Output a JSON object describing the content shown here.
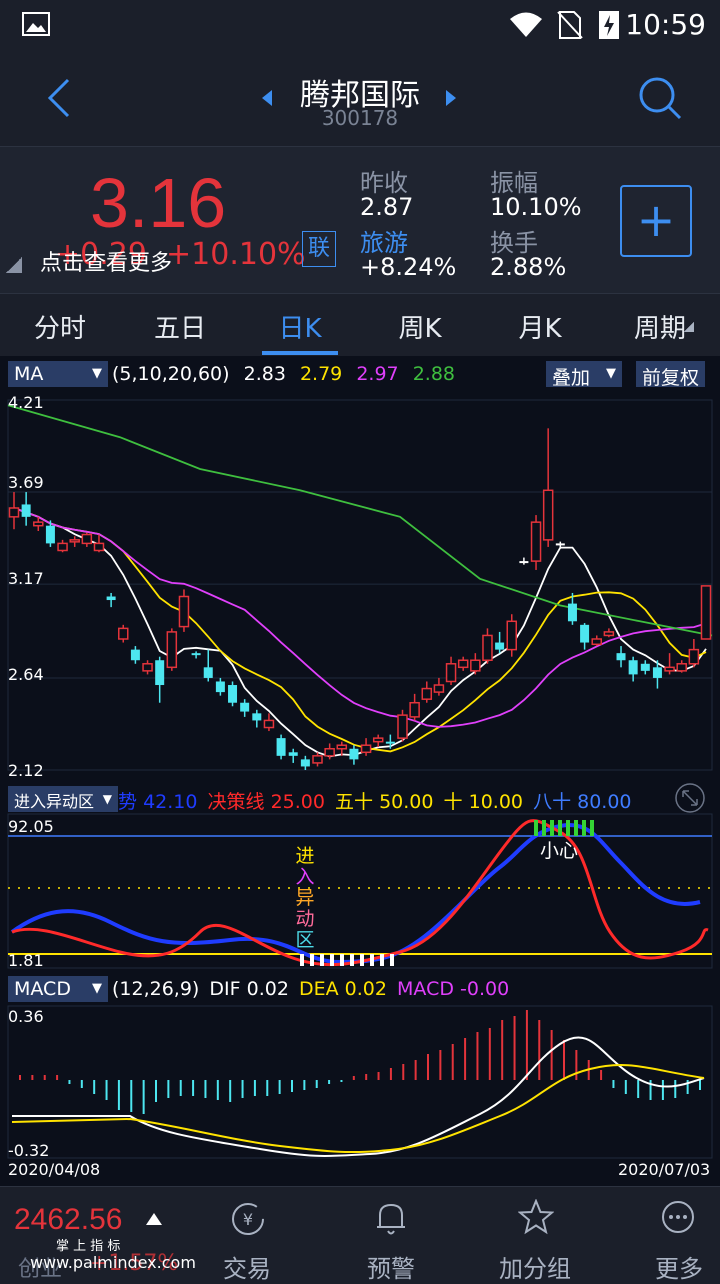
{
  "status": {
    "time": "10:59"
  },
  "header": {
    "title": "腾邦国际",
    "code": "300178"
  },
  "quote": {
    "price": "3.16",
    "change": "+0.29",
    "change_pct": "+10.10%",
    "hint": "点击查看更多",
    "link_badge": "联",
    "prev_close_label": "昨收",
    "prev_close": "2.87",
    "sector_label": "旅游",
    "sector_value": "+8.24%",
    "amplitude_label": "振幅",
    "amplitude": "10.10%",
    "turnover_label": "换手",
    "turnover": "2.88%",
    "add_symbol": "+"
  },
  "tabs": [
    "分时",
    "五日",
    "日K",
    "周K",
    "月K",
    "周期"
  ],
  "active_tab": 2,
  "ma": {
    "selector": "MA",
    "params": "(5,10,20,60)",
    "v5": "2.83",
    "v10": "2.79",
    "v20": "2.97",
    "v60": "2.88",
    "overlay": "叠加",
    "adjust": "前复权",
    "y_ticks": [
      "4.21",
      "3.69",
      "3.17",
      "2.64",
      "2.12"
    ]
  },
  "indicator2": {
    "selector": "进入异动区",
    "labels": [
      {
        "name": "势",
        "value": "42.10",
        "color": "#1f3cff"
      },
      {
        "name": "决策线",
        "value": "25.00",
        "color": "#ff2a2a"
      },
      {
        "name": "五十",
        "value": "50.00",
        "color": "#ffe300"
      },
      {
        "name": "十",
        "value": "10.00",
        "color": "#ffe300"
      },
      {
        "name": "八十",
        "value": "80.00",
        "color": "#3f7cff"
      }
    ],
    "top": "92.05",
    "bottom": "1.81",
    "vtext": [
      "进",
      "入",
      "异",
      "动",
      "区"
    ],
    "careful": "小心"
  },
  "macd": {
    "selector": "MACD",
    "params": "(12,26,9)",
    "dif_label": "DIF",
    "dif": "0.02",
    "dea_label": "DEA",
    "dea": "0.02",
    "macd_label": "MACD",
    "macd": "-0.00",
    "top": "0.36",
    "bottom": "-0.32",
    "date_start": "2020/04/08",
    "date_end": "2020/07/03"
  },
  "bottom": {
    "index_value": "2462.56",
    "index_name": "创业",
    "index_change": "+1.57%",
    "watermark": "掌 上 指 标",
    "watermark_url": "www.palmindex.com",
    "nav": [
      "交易",
      "预警",
      "加分组",
      "更多"
    ]
  },
  "chart_data": {
    "type": "candlestick",
    "candles": [
      [
        3.55,
        3.6,
        3.69,
        3.48,
        "up"
      ],
      [
        3.62,
        3.55,
        3.69,
        3.5,
        "down"
      ],
      [
        3.52,
        3.5,
        3.55,
        3.47,
        "up"
      ],
      [
        3.5,
        3.4,
        3.53,
        3.38,
        "down"
      ],
      [
        3.36,
        3.4,
        3.42,
        3.35,
        "up"
      ],
      [
        3.42,
        3.41,
        3.44,
        3.38,
        "up"
      ],
      [
        3.45,
        3.4,
        3.46,
        3.38,
        "up"
      ],
      [
        3.4,
        3.36,
        3.45,
        3.35,
        "up"
      ],
      [
        3.1,
        3.08,
        3.12,
        3.04,
        "down"
      ],
      [
        2.92,
        2.86,
        2.94,
        2.84,
        "up"
      ],
      [
        2.8,
        2.74,
        2.82,
        2.72,
        "down"
      ],
      [
        2.72,
        2.68,
        2.74,
        2.66,
        "up"
      ],
      [
        2.74,
        2.6,
        2.76,
        2.5,
        "down"
      ],
      [
        2.7,
        2.9,
        2.92,
        2.68,
        "up"
      ],
      [
        2.93,
        3.1,
        3.14,
        2.9,
        "up"
      ],
      [
        2.78,
        2.77,
        2.79,
        2.75,
        "down"
      ],
      [
        2.7,
        2.64,
        2.8,
        2.62,
        "down"
      ],
      [
        2.62,
        2.56,
        2.64,
        2.54,
        "down"
      ],
      [
        2.6,
        2.5,
        2.62,
        2.48,
        "down"
      ],
      [
        2.5,
        2.45,
        2.52,
        2.42,
        "down"
      ],
      [
        2.44,
        2.4,
        2.46,
        2.36,
        "down"
      ],
      [
        2.4,
        2.36,
        2.44,
        2.34,
        "up"
      ],
      [
        2.3,
        2.2,
        2.32,
        2.18,
        "down"
      ],
      [
        2.22,
        2.2,
        2.24,
        2.16,
        "down"
      ],
      [
        2.18,
        2.14,
        2.2,
        2.12,
        "down"
      ],
      [
        2.16,
        2.2,
        2.22,
        2.14,
        "up"
      ],
      [
        2.2,
        2.24,
        2.27,
        2.18,
        "up"
      ],
      [
        2.24,
        2.26,
        2.28,
        2.2,
        "up"
      ],
      [
        2.24,
        2.18,
        2.26,
        2.15,
        "down"
      ],
      [
        2.22,
        2.26,
        2.3,
        2.2,
        "up"
      ],
      [
        2.28,
        2.3,
        2.32,
        2.25,
        "up"
      ],
      [
        2.28,
        2.27,
        2.32,
        2.24,
        "down"
      ],
      [
        2.3,
        2.43,
        2.46,
        2.28,
        "up"
      ],
      [
        2.42,
        2.5,
        2.55,
        2.4,
        "up"
      ],
      [
        2.52,
        2.58,
        2.62,
        2.5,
        "up"
      ],
      [
        2.56,
        2.6,
        2.64,
        2.54,
        "up"
      ],
      [
        2.62,
        2.72,
        2.76,
        2.6,
        "up"
      ],
      [
        2.7,
        2.74,
        2.76,
        2.68,
        "up"
      ],
      [
        2.68,
        2.74,
        2.78,
        2.66,
        "up"
      ],
      [
        2.74,
        2.88,
        2.92,
        2.72,
        "up"
      ],
      [
        2.84,
        2.8,
        2.9,
        2.78,
        "down"
      ],
      [
        2.8,
        2.96,
        3.0,
        2.76,
        "up"
      ],
      [
        3.3,
        3.3,
        3.32,
        3.28,
        "flat"
      ],
      [
        3.3,
        3.52,
        3.56,
        3.25,
        "up"
      ],
      [
        3.42,
        3.7,
        4.05,
        3.38,
        "up"
      ],
      [
        3.4,
        3.4,
        3.41,
        3.37,
        "flat"
      ],
      [
        3.06,
        2.96,
        3.12,
        2.94,
        "down"
      ],
      [
        2.94,
        2.84,
        2.95,
        2.8,
        "down"
      ],
      [
        2.83,
        2.86,
        2.88,
        2.82,
        "up"
      ],
      [
        2.88,
        2.9,
        2.92,
        2.87,
        "up"
      ],
      [
        2.78,
        2.74,
        2.82,
        2.7,
        "down"
      ],
      [
        2.74,
        2.66,
        2.76,
        2.62,
        "down"
      ],
      [
        2.72,
        2.68,
        2.74,
        2.66,
        "down"
      ],
      [
        2.7,
        2.64,
        2.74,
        2.58,
        "down"
      ],
      [
        2.68,
        2.7,
        2.78,
        2.66,
        "up"
      ],
      [
        2.68,
        2.72,
        2.74,
        2.67,
        "up"
      ],
      [
        2.72,
        2.8,
        2.86,
        2.7,
        "up"
      ],
      [
        2.86,
        3.16,
        3.16,
        2.86,
        "up"
      ]
    ]
  }
}
